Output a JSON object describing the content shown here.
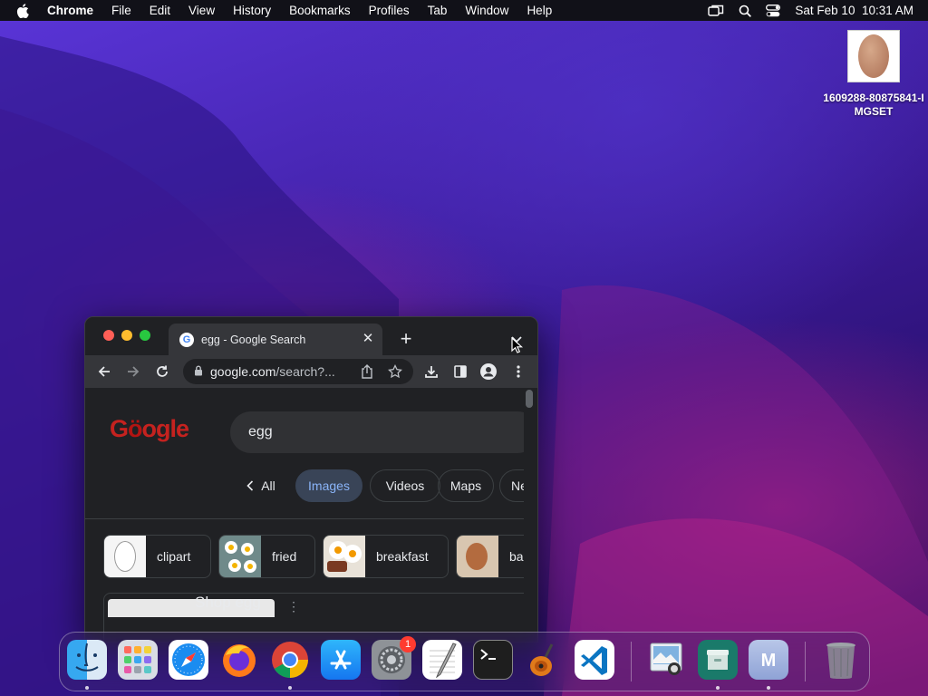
{
  "menubar": {
    "app_name": "Chrome",
    "items": [
      "File",
      "Edit",
      "View",
      "History",
      "Bookmarks",
      "Profiles",
      "Tab",
      "Window",
      "Help"
    ],
    "datetime": "Sat Feb 10  10:31 AM"
  },
  "desktop": {
    "file_label": "1609288-80875841-IMGSET"
  },
  "browser": {
    "tab_title": "egg - Google Search",
    "url_host": "google.com",
    "url_path": "/search?...",
    "search_query": "egg",
    "filters": {
      "all": "All",
      "images": "Images",
      "videos": "Videos",
      "maps": "Maps",
      "news": "Ne"
    },
    "active_filter": "Images",
    "refinements": [
      "clipart",
      "fried",
      "breakfast",
      "ba"
    ],
    "result_title": "Shop egg"
  },
  "dock": {
    "apps": [
      "finder-icon",
      "launchpad-icon",
      "safari-icon",
      "firefox-icon",
      "chrome-icon",
      "app-store-icon",
      "system-preferences-icon",
      "textedit-icon",
      "terminal-icon",
      "garageband-icon",
      "vscode-icon",
      "preview-icon",
      "archive-utility-icon",
      "m-app-icon",
      "trash-icon"
    ],
    "system_preferences_badge": "1"
  },
  "colors": {
    "menubar_bg": "#111118",
    "browser_bg": "#202124",
    "toolbar_bg": "#35363a",
    "active_chip_text": "#8ab4f8"
  }
}
